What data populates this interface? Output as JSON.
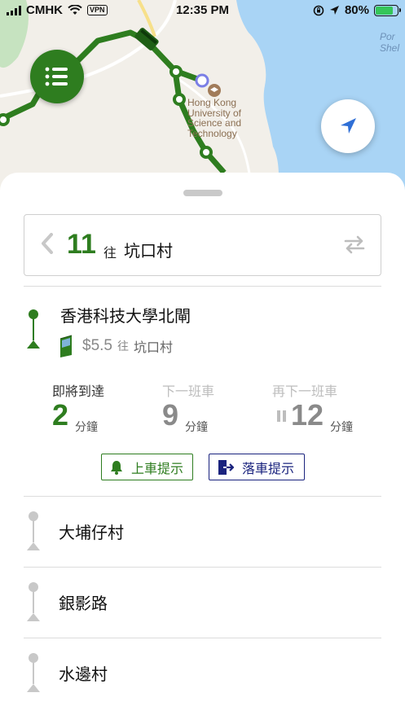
{
  "status_bar": {
    "carrier": "CMHK",
    "vpn": "VPN",
    "time": "12:35 PM",
    "battery": "80%"
  },
  "map": {
    "poi_lines": [
      "Hong Kong",
      "University of",
      "Science and",
      "Technology"
    ],
    "port_label_lines": [
      "Por",
      "Shel"
    ]
  },
  "route": {
    "number": "11",
    "direction_word": "往",
    "destination": "坑口村"
  },
  "current_stop": {
    "name": "香港科技大學北閘",
    "fare": "$5.5",
    "fare_direction_word": "往",
    "fare_destination": "坑口村"
  },
  "eta": [
    {
      "label": "即將到達",
      "value": "2",
      "unit": "分鐘"
    },
    {
      "label": "下一班車",
      "value": "9",
      "unit": "分鐘"
    },
    {
      "label": "再下一班車",
      "value": "12",
      "unit": "分鐘"
    }
  ],
  "buttons": {
    "board_alert": "上車提示",
    "alight_alert": "落車提示"
  },
  "next_stops": [
    {
      "name": "大埔仔村"
    },
    {
      "name": "銀影路"
    },
    {
      "name": "水邊村"
    }
  ],
  "colors": {
    "route_green": "#2e7d1f",
    "alight_navy": "#1a237e",
    "sea_blue": "#a9d4f5",
    "muted_gray": "#c8c8c8"
  }
}
